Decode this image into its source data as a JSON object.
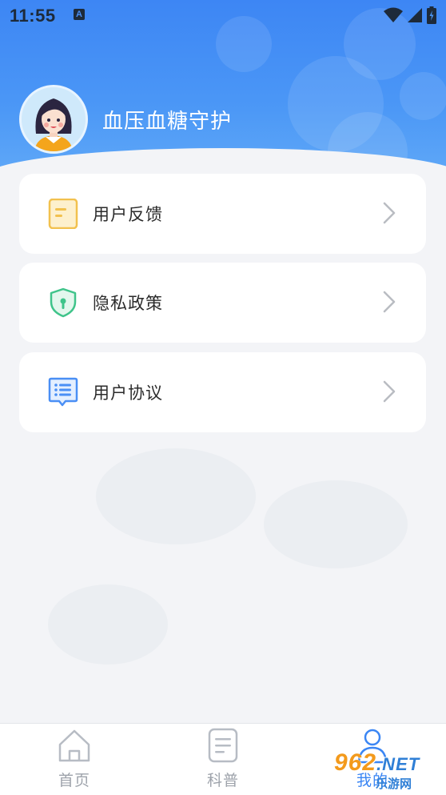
{
  "status_bar": {
    "time": "11:55",
    "notification_icon": "A"
  },
  "profile": {
    "name": "血压血糖守护"
  },
  "menu": [
    {
      "label": "用户反馈",
      "icon": "feedback-document-icon",
      "color": "#f2c14e"
    },
    {
      "label": "隐私政策",
      "icon": "shield-icon",
      "color": "#3fc48a"
    },
    {
      "label": "用户协议",
      "icon": "agreement-list-icon",
      "color": "#4a8ff5"
    }
  ],
  "tabbar": {
    "tabs": [
      {
        "label": "首页",
        "icon": "home-icon",
        "active": false
      },
      {
        "label": "科普",
        "icon": "article-icon",
        "active": false
      },
      {
        "label": "我的",
        "icon": "user-icon",
        "active": true
      }
    ]
  },
  "watermark": {
    "line1_number": "962",
    "line1_suffix": ".NET",
    "line2": "乐游网"
  },
  "colors": {
    "header_gradient_top": "#3d86f4",
    "header_gradient_bottom": "#64acf8",
    "accent": "#3b86f4",
    "page_background": "#f3f4f7"
  }
}
